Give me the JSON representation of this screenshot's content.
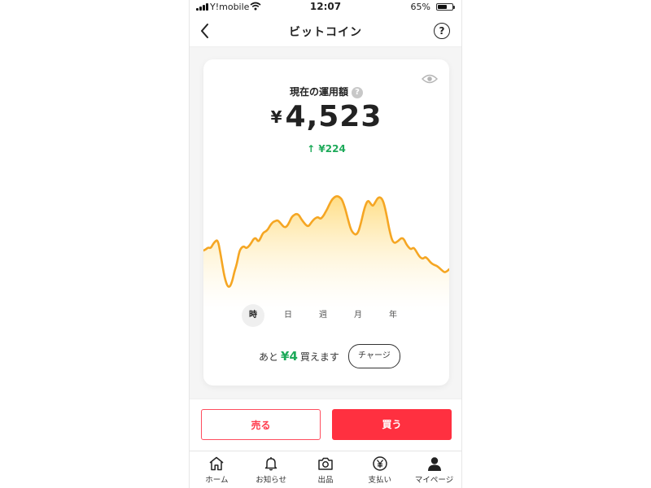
{
  "status_bar": {
    "carrier": "Y!mobile",
    "time": "12:07",
    "battery": "65%",
    "battery_level": 0.65
  },
  "header": {
    "title": "ビットコイン",
    "help_label": "?"
  },
  "balance": {
    "label": "現在の運用額",
    "info_label": "?",
    "currency": "¥",
    "amount": "4,523",
    "change_arrow": "↑",
    "change": "¥224",
    "change_color": "#1eaa5a"
  },
  "chart_data": {
    "type": "area",
    "line_color": "#f5a623",
    "y": [
      21,
      22,
      24,
      23,
      27,
      30,
      31,
      20,
      6,
      -6,
      -13,
      -14,
      -9,
      1,
      8,
      20,
      24,
      25,
      23,
      25,
      28,
      32,
      33,
      29,
      33,
      38,
      39,
      41,
      45,
      48,
      49,
      50,
      48,
      45,
      43,
      44,
      48,
      53,
      55,
      56,
      55,
      51,
      48,
      45,
      44,
      47,
      50,
      52,
      53,
      51,
      53,
      57,
      61,
      66,
      70,
      72,
      73,
      72,
      70,
      64,
      56,
      47,
      40,
      37,
      36,
      39,
      47,
      57,
      65,
      69,
      66,
      63,
      67,
      71,
      72,
      70,
      63,
      52,
      40,
      31,
      28,
      29,
      31,
      33,
      32,
      27,
      24,
      22,
      24,
      21,
      17,
      14,
      13,
      15,
      13,
      10,
      8,
      7,
      6,
      4,
      2,
      0,
      1,
      3
    ]
  },
  "periods": {
    "items": [
      "時",
      "日",
      "週",
      "月",
      "年"
    ],
    "active": 0
  },
  "buy_more": {
    "prefix": "あと",
    "amount": "¥4",
    "suffix": "買えます",
    "charge_label": "チャージ"
  },
  "actions": {
    "sell_label": "売る",
    "buy_label": "買う",
    "buy_color": "#ff3040",
    "sell_color": "#ff3b4d"
  },
  "tabbar": {
    "items": [
      {
        "label": "ホーム",
        "icon": "home-icon"
      },
      {
        "label": "お知らせ",
        "icon": "bell-icon"
      },
      {
        "label": "出品",
        "icon": "camera-icon"
      },
      {
        "label": "支払い",
        "icon": "yen-icon"
      },
      {
        "label": "マイページ",
        "icon": "user-icon"
      }
    ]
  }
}
